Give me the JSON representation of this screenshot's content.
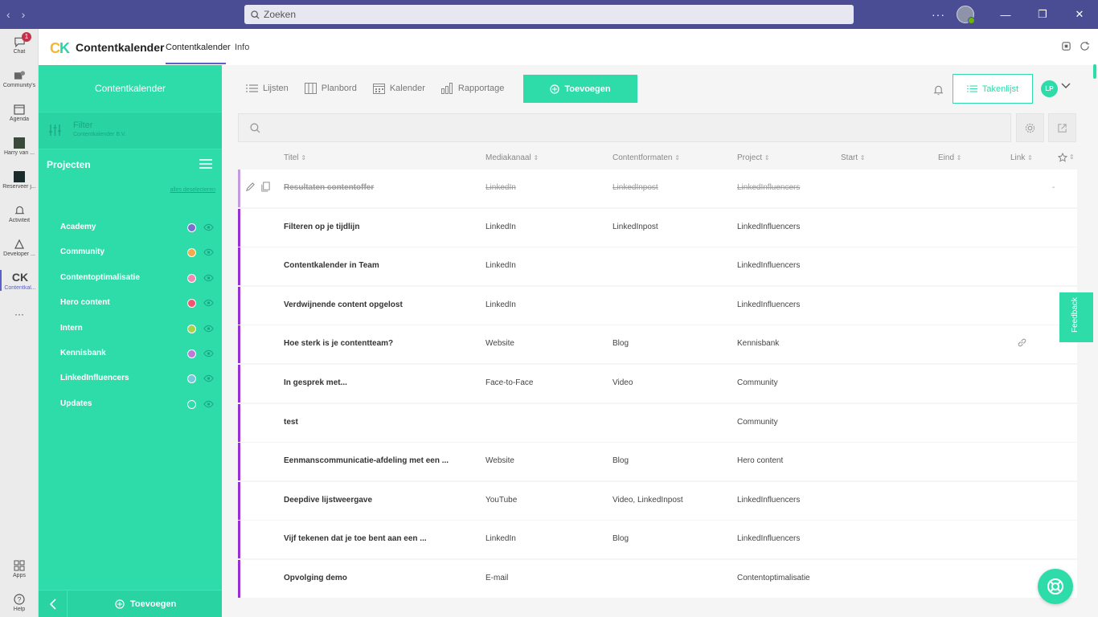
{
  "titlebar": {
    "search_placeholder": "Zoeken",
    "more": "···"
  },
  "rail": {
    "chat_badge": "1",
    "items": [
      {
        "label": "Chat"
      },
      {
        "label": "Community's"
      },
      {
        "label": "Agenda"
      },
      {
        "label": "Harry van ..."
      },
      {
        "label": "Reserveer j..."
      },
      {
        "label": "Activiteit"
      },
      {
        "label": "Developer ..."
      },
      {
        "label": "Contentkal..."
      },
      {
        "label": "Apps"
      },
      {
        "label": "Help"
      }
    ],
    "more": "···"
  },
  "app": {
    "logo_c": "C",
    "logo_k": "K",
    "title": "Contentkalender",
    "tabs": [
      {
        "label": "Contentkalender"
      },
      {
        "label": "Info"
      }
    ]
  },
  "sidebar": {
    "title": "Contentkalender",
    "filter_label": "Filter",
    "filter_sub": "Contentkalender B.V.",
    "projects_label": "Projecten",
    "deselect": "alles deselecteren",
    "projects": [
      {
        "name": "Academy",
        "color": "#7b6fd1"
      },
      {
        "name": "Community",
        "color": "#f6a84a"
      },
      {
        "name": "Contentoptimalisatie",
        "color": "#f08ab0"
      },
      {
        "name": "Hero content",
        "color": "#f2556d"
      },
      {
        "name": "Intern",
        "color": "#a7d24c"
      },
      {
        "name": "Kennisbank",
        "color": "#c07ad6"
      },
      {
        "name": "LinkedInfluencers",
        "color": "#78c9d8"
      },
      {
        "name": "Updates",
        "color": "#2edcaa"
      }
    ],
    "add_label": "Toevoegen"
  },
  "toolbar": {
    "views": [
      {
        "label": "Lijsten"
      },
      {
        "label": "Planbord"
      },
      {
        "label": "Kalender"
      },
      {
        "label": "Rapportage"
      }
    ],
    "add_label": "Toevoegen",
    "tasks_label": "Takenlijst",
    "user_initials": "LP"
  },
  "table": {
    "columns": [
      "Titel",
      "Mediakanaal",
      "Contentformaten",
      "Project",
      "Start",
      "Eind",
      "Link"
    ],
    "sort_glyph": "⇕",
    "rows": [
      {
        "title": "Resultaten contentoffer",
        "channel": "LinkedIn",
        "format": "LinkedInpost",
        "project": "LinkedInfluencers",
        "link": "-"
      },
      {
        "title": "Filteren op je tijdlijn",
        "channel": "LinkedIn",
        "format": "LinkedInpost",
        "project": "LinkedInfluencers",
        "link": ""
      },
      {
        "title": "Contentkalender in Team",
        "channel": "LinkedIn",
        "format": "",
        "project": "LinkedInfluencers",
        "link": ""
      },
      {
        "title": "Verdwijnende content opgelost",
        "channel": "LinkedIn",
        "format": "",
        "project": "LinkedInfluencers",
        "link": ""
      },
      {
        "title": "Hoe sterk is je contentteam?",
        "channel": "Website",
        "format": "Blog",
        "project": "Kennisbank",
        "link": ""
      },
      {
        "title": "In gesprek met...",
        "channel": "Face-to-Face",
        "format": "Video",
        "project": "Community",
        "link": ""
      },
      {
        "title": "test",
        "channel": "",
        "format": "",
        "project": "Community",
        "link": ""
      },
      {
        "title": "Eenmanscommunicatie-afdeling met een ...",
        "channel": "Website",
        "format": "Blog",
        "project": "Hero content",
        "link": ""
      },
      {
        "title": "Deepdive lijstweergave",
        "channel": "YouTube",
        "format": "Video, LinkedInpost",
        "project": "LinkedInfluencers",
        "link": ""
      },
      {
        "title": "Vijf tekenen dat je toe bent aan een ...",
        "channel": "LinkedIn",
        "format": "Blog",
        "project": "LinkedInfluencers",
        "link": ""
      },
      {
        "title": "Opvolging demo",
        "channel": "E-mail",
        "format": "",
        "project": "Contentoptimalisatie",
        "link": ""
      }
    ]
  },
  "feedback_label": "Feedback"
}
